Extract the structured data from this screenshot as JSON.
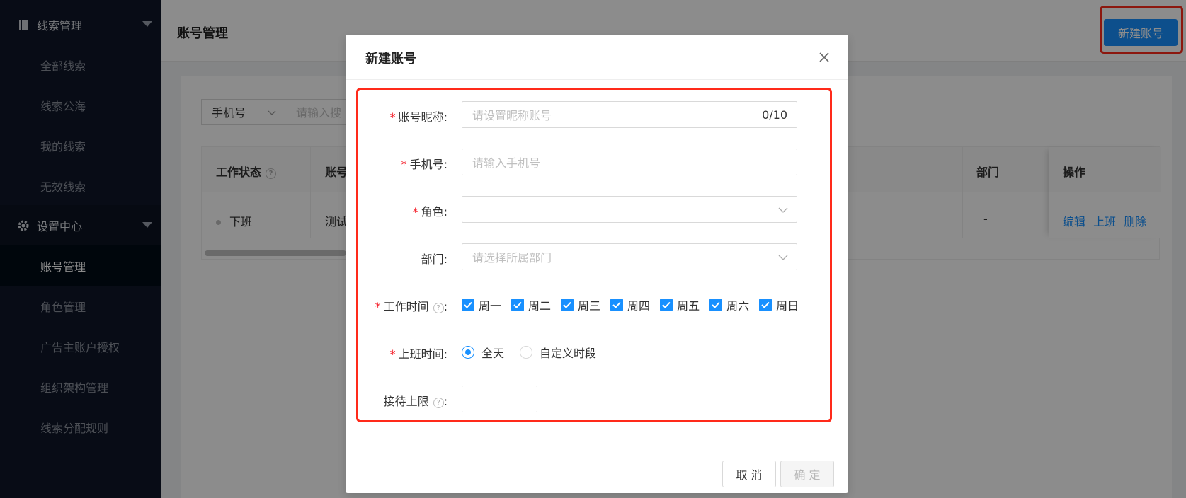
{
  "sidebar": {
    "group_leads": {
      "label": "线索管理",
      "icon": "book-icon"
    },
    "leads_items": [
      {
        "label": "全部线索"
      },
      {
        "label": "线索公海"
      },
      {
        "label": "我的线索"
      },
      {
        "label": "无效线索"
      }
    ],
    "group_settings": {
      "label": "设置中心",
      "icon": "gear-icon"
    },
    "settings_items": [
      {
        "label": "账号管理",
        "active": true
      },
      {
        "label": "角色管理"
      },
      {
        "label": "广告主账户授权"
      },
      {
        "label": "组织架构管理"
      },
      {
        "label": "线索分配规则"
      }
    ]
  },
  "header": {
    "title": "账号管理",
    "new_button": "新建账号"
  },
  "filter": {
    "select_value": "手机号",
    "search_placeholder": "请输入搜"
  },
  "table": {
    "columns": {
      "status": "工作状态",
      "account": "账号",
      "dept": "部门",
      "ops": "操作"
    },
    "row": {
      "status": "下班",
      "account": "测试",
      "dept": "-",
      "actions": {
        "edit": "编辑",
        "on": "上班",
        "delete": "删除"
      }
    }
  },
  "modal": {
    "title": "新建账号",
    "fields": {
      "nickname": {
        "label": "账号昵称",
        "placeholder": "请设置昵称账号",
        "counter": "0/10"
      },
      "phone": {
        "label": "手机号",
        "placeholder": "请输入手机号"
      },
      "role": {
        "label": "角色",
        "value": ""
      },
      "dept": {
        "label": "部门",
        "placeholder": "请选择所属部门"
      },
      "work_time": {
        "label": "工作时间",
        "days": [
          "周一",
          "周二",
          "周三",
          "周四",
          "周五",
          "周六",
          "周日"
        ]
      },
      "shift": {
        "label": "上班时间",
        "options": [
          "全天",
          "自定义时段"
        ],
        "selected": "全天"
      },
      "limit": {
        "label": "接待上限",
        "value": ""
      }
    },
    "colon": ":",
    "cancel": "取 消",
    "ok": "确 定"
  },
  "colors": {
    "primary": "#1890ff",
    "highlight": "#ff2a1a",
    "sidebar_bg": "#0f1729",
    "required": "#f5222d"
  }
}
